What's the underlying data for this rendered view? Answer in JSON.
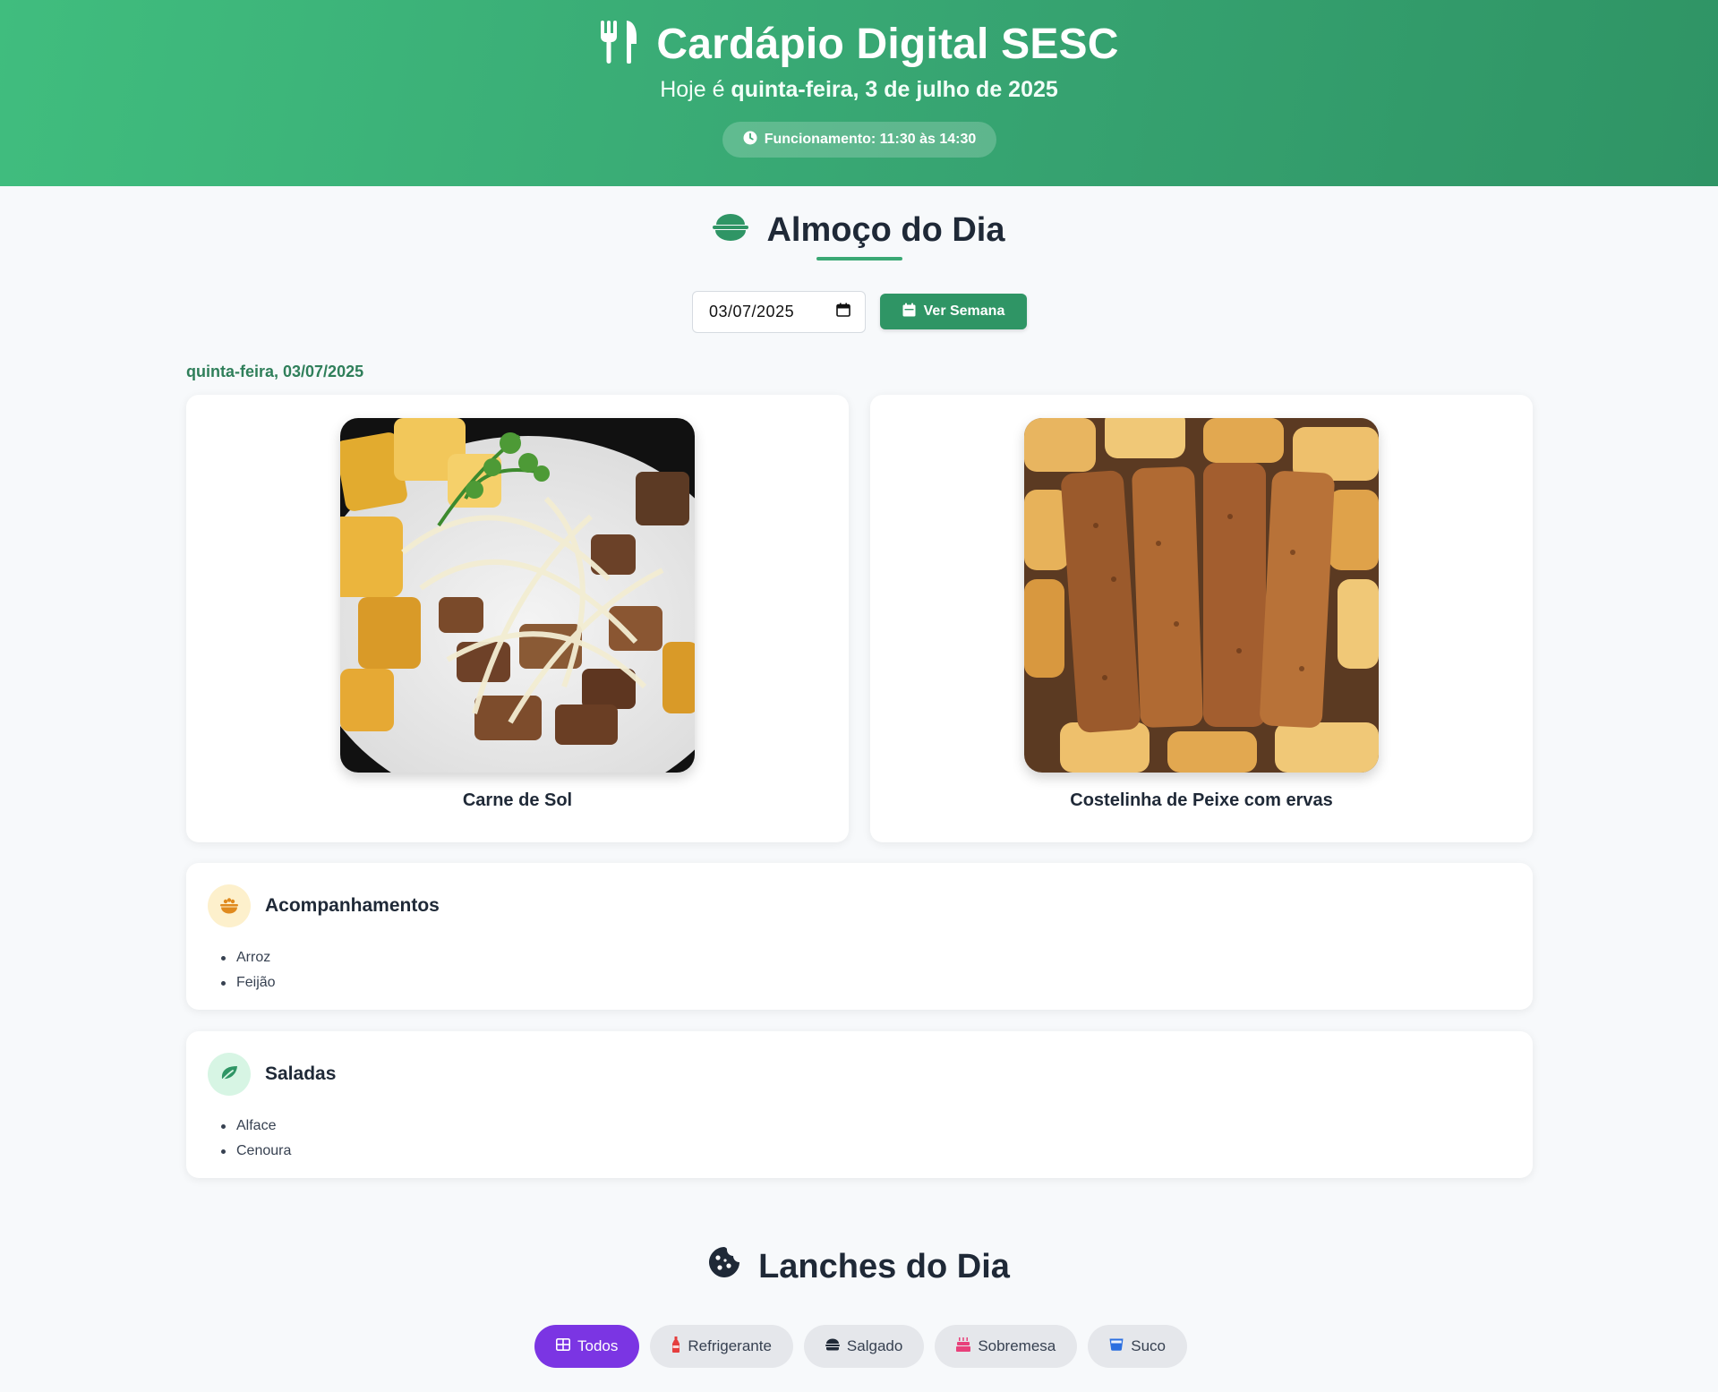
{
  "header": {
    "title": "Cardápio Digital SESC",
    "date_prefix": "Hoje é",
    "date_text": "quinta-feira, 3 de julho de 2025",
    "hours_label": "Funcionamento: 11:30 às 14:30",
    "icon": "utensils-icon"
  },
  "lunch": {
    "title": "Almoço do Dia",
    "icon": "bowl-icon",
    "date_value": "03/07/2025",
    "week_button_label": "Ver Semana",
    "day_label": "quinta-feira, 03/07/2025",
    "dishes": [
      {
        "name": "Carne de Sol"
      },
      {
        "name": "Costelinha de Peixe com ervas"
      }
    ],
    "sections": [
      {
        "title": "Acompanhamentos",
        "icon": "rice-bowl-icon",
        "items": [
          "Arroz",
          "Feijão"
        ]
      },
      {
        "title": "Saladas",
        "icon": "leaf-icon",
        "items": [
          "Alface",
          "Cenoura"
        ]
      }
    ]
  },
  "snacks": {
    "title": "Lanches do Dia",
    "icon": "cookie-icon",
    "filters": [
      {
        "label": "Todos",
        "icon": "grid-icon",
        "active": true
      },
      {
        "label": "Refrigerante",
        "icon": "bottle-icon",
        "active": false
      },
      {
        "label": "Salgado",
        "icon": "burger-icon",
        "active": false
      },
      {
        "label": "Sobremesa",
        "icon": "cake-icon",
        "active": false
      },
      {
        "label": "Suco",
        "icon": "cup-icon",
        "active": false
      }
    ]
  },
  "colors": {
    "header_start": "#40bd7e",
    "header_end": "#2f9465",
    "primary": "#2f9565",
    "active_chip": "#7b35e3"
  }
}
